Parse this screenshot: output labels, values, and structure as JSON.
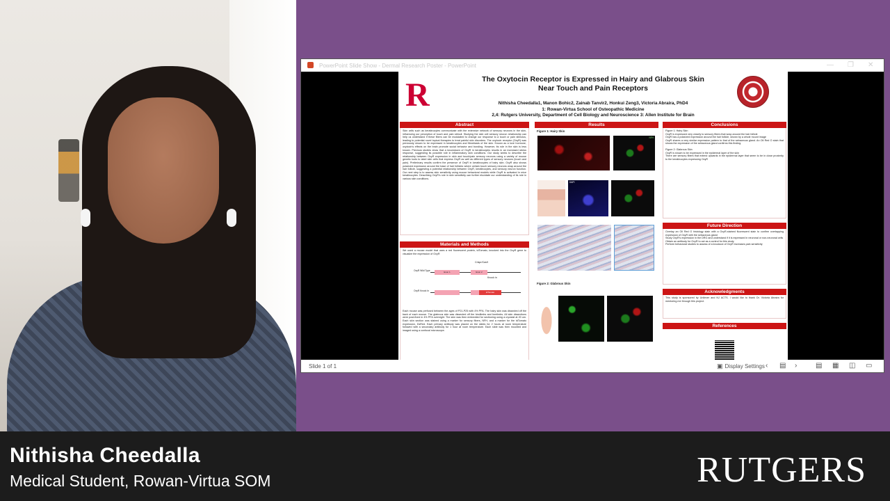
{
  "speaker": {
    "name": "Nithisha Cheedalla",
    "role": "Medical Student, Rowan-Virtua SOM"
  },
  "brand": {
    "logo_text": "RUTGERS"
  },
  "ppt": {
    "window_title": "PowerPoint Slide Show  -  Dermal Research Poster  -  PowerPoint",
    "status": {
      "slide_indicator": "Slide 1 of 1",
      "display_settings": "Display Settings"
    },
    "icons": [
      "powerpoint-icon",
      "minimize-icon",
      "restore-icon",
      "close-icon",
      "monitor-icon",
      "prev-slide-icon",
      "slide-menu-icon",
      "next-slide-icon",
      "normal-view-icon",
      "slide-sorter-icon",
      "reading-view-icon",
      "slideshow-view-icon"
    ]
  },
  "poster": {
    "title_line1": "The Oxytocin Receptor is Expressed in Hairy and Glabrous Skin",
    "title_line2": "Near Touch and Pain Receptors",
    "authors": "Nithisha Cheedalla1, Manon Bohic2, Zainab Tanvir2, Honkui Zeng3, Victoria Abraira, PhD4",
    "affiliation1": "1: Rowan-Virtua School of Osteopathic Medicine",
    "affiliation2": "2,4: Rutgers University, Department of Cell Biology and Neuroscience  3: Allen Institute for Brain",
    "logo_left": "R",
    "sections": {
      "abstract": {
        "heading": "Abstract",
        "text": "Skin cells such as keratinocytes communicate with the extensive network of sensory neurons in the skin, influencing our perception of touch and pain stimuli. Studying the skin cell sensory neuron relationship can help us understand if these fibers can be modulated to change our response to a touch or pain stimulus, leading to potential novel topical therapies to treat painful skin disorders. The oxytocin receptor (OxyR) was previously shown to be expressed in keratinocytes and fibroblasts of the skin. Known as a love hormone, oxytocin's effects on the brain promote social behavior and bonding. However, its role in the skin is less known. Previous studies show that a knockdown of OxyR in keratinocytes results in an increased stress response, suggesting its possible role in inflammatory skin conditions. Our study seeks to describe the relationship between OxyR expression in skin and touch/pain sensory neurons using a variety of mouse genetic tools to label skin cells that express OxyR as well as different types of sensory neurons (touch and pain). Preliminary results confirm the presence of OxyR in keratinocytes of hairy skin. OxyR also shows polarized expression around the base of hair follicles where certain touch sensory neurons wrap around the hair follicle, suggesting a potential relationship between OxyR, keratinocytes, and sensory neuron function. Our next step is to assess skin sensitivity using mouse behavioral models while OxyR is activated in mice keratinocytes. Describing OxyR's role in skin sensitivity can further elucidate our understanding of its role in various skin conditions."
      },
      "methods": {
        "heading": "Materials and Methods",
        "intro": "We used a mouse model that uses a red fluorescent protein, tdTomato, knocked into the OxyR gene to visualize the expression of OxyR",
        "diagram_labels": {
          "crispr": "Crispr/Cas9",
          "knock_in": "Knock in",
          "wild_type": "OxyR Wild Type",
          "knock_in_row": "OxyR Knock In",
          "exon1": "Exon 1",
          "exon2": "Exon 2",
          "tdtomato": "tdTomato"
        },
        "text": "Each mouse was perfused between the ages of P21-P25 with 4% PFA. The hairy skin was dissected off the back of each mouse. The glabrous skin was dissected off the hindlimbs and forelimbs. All skin dissections were post-fixed in 4% PFA overnight. The skin was then embedded for sectioning using a cryostat at 20 um. Each skin section was stained using a marker for sensory fibers, NFH, and a marker for the tdTomato expression, DsRed. Each primary antibody was placed on the slides for 2 hours at room temperature followed with a secondary antibody for 1 hour at room temperature. Each slide was then mounted and imaged using a confocal microscope."
      },
      "results": {
        "heading": "Results",
        "fig1": "Figure 1: Hairy Skin",
        "fig2": "Figure 2: Glabrous Skin",
        "fig_tag_dapi": "DAPI",
        "fig_tag_nfh": "NFH"
      },
      "conclusions": {
        "heading": "Conclusions",
        "fig1_label": "Figure 1: Hairy Skin",
        "fig1_points": [
          "OxyR is expressed very closely to sensory fibers that wrap around the hair follicle",
          "OxyR has a polarized expression around the hair follicle, shown by a whole mount image",
          "OxyR shares a very similar expression pattern to that of the sebaceous gland. An Oil Red O stain that shows the expression of the sebaceous gland confirms this finding."
        ],
        "fig2_label": "Figure 2: Glabrous Skin",
        "fig2_points": [
          "OxyR is shown to be expressed in the epidermal layer of the skin",
          "There are sensory fibers that extend upwards in the epidermal layer that seem to be in close proximity to the keratinocytes expressing OxyR"
        ]
      },
      "future": {
        "heading": "Future Direction",
        "points": [
          "Overlay an Oil Red O histology stain with a OxyR-stained fluorescent stain to confirm overlapping expression of OxyR with the sebaceous gland",
          "Study OxyR's expression in the DRG and understand if it is expressed in neuronal or non-neuronal cells",
          "Obtain an antibody for OxyR to act as a control for this study",
          "Perform behavioral studies to assess of a knockout of OxyR increases pain sensitivity"
        ]
      },
      "acknowledgments": {
        "heading": "Acknowledgments",
        "text": "This study is sponsored by Unilever and NJ ACTS. I would like to thank Dr. Victoria Abraira for mentoring me through this project."
      },
      "references": {
        "heading": "References"
      }
    }
  }
}
